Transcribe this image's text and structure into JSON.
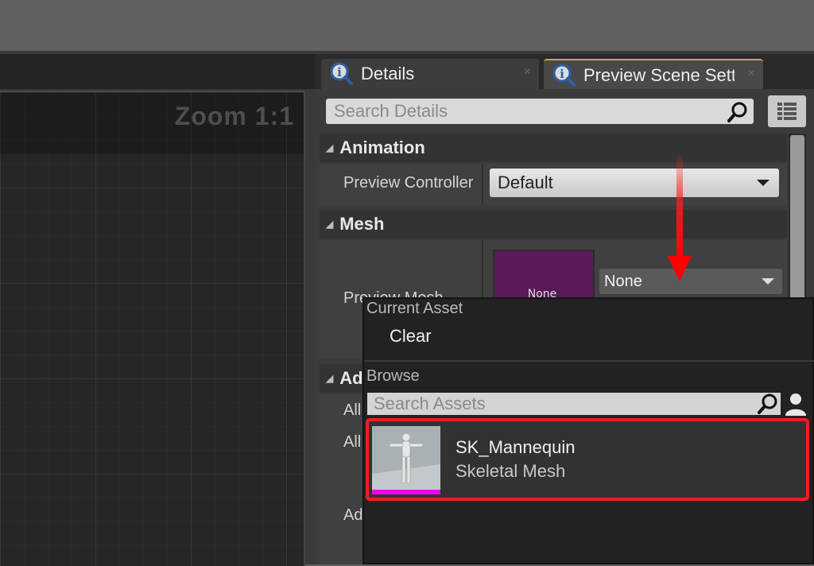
{
  "viewport": {
    "zoom_label": "Zoom 1:1"
  },
  "tabs": [
    {
      "label": "Details",
      "close": "×"
    },
    {
      "label": "Preview Scene Sett",
      "close": "×"
    }
  ],
  "details": {
    "search_placeholder": "Search Details",
    "sections": {
      "animation": {
        "title": "Animation",
        "preview_controller_label": "Preview Controller",
        "preview_controller_value": "Default"
      },
      "mesh": {
        "title": "Mesh",
        "preview_mesh_label": "Preview Mesh",
        "thumb_text": "None",
        "mesh_value": "None"
      },
      "additional": {
        "title": "Ad",
        "row1": "All",
        "row2": "All",
        "row3": "Ad"
      }
    }
  },
  "asset_picker": {
    "current_asset_heading": "Current Asset",
    "clear_label": "Clear",
    "browse_heading": "Browse",
    "search_placeholder": "Search Assets",
    "items": [
      {
        "name": "SK_Mannequin",
        "type": "Skeletal Mesh"
      }
    ]
  },
  "colors": {
    "highlight": "#ff1a1a",
    "tab_accent": "#c9a64a",
    "asset_type_bar": "#ee00ee",
    "mesh_thumb": "#5a1a5a"
  }
}
